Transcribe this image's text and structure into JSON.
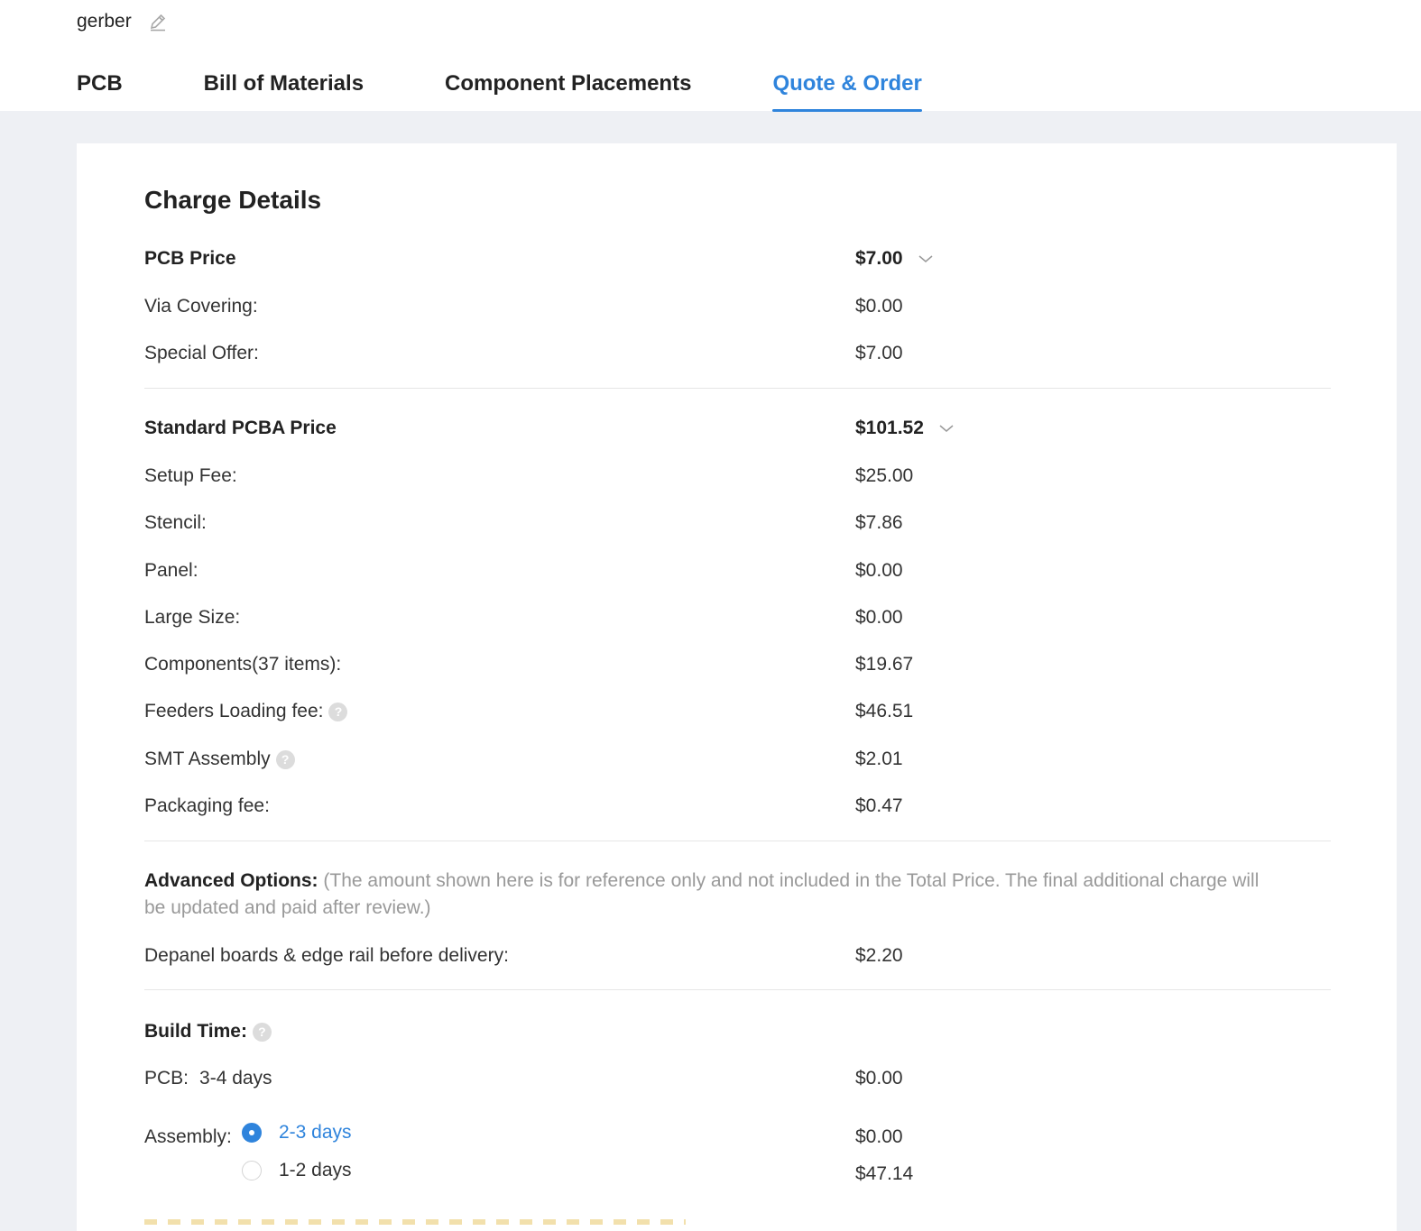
{
  "header": {
    "filename": "gerber"
  },
  "tabs": [
    {
      "label": "PCB"
    },
    {
      "label": "Bill of Materials"
    },
    {
      "label": "Component Placements"
    },
    {
      "label": "Quote & Order"
    }
  ],
  "charge": {
    "title": "Charge Details",
    "pcb": {
      "label": "PCB Price",
      "value": "$7.00",
      "items": [
        {
          "label": "Via Covering:",
          "value": "$0.00"
        },
        {
          "label": "Special Offer:",
          "value": "$7.00"
        }
      ]
    },
    "pcba": {
      "label": "Standard PCBA Price",
      "value": "$101.52",
      "items": [
        {
          "label": "Setup Fee:",
          "value": "$25.00"
        },
        {
          "label": "Stencil:",
          "value": "$7.86"
        },
        {
          "label": "Panel:",
          "value": "$0.00"
        },
        {
          "label": "Large Size:",
          "value": "$0.00"
        },
        {
          "label": "Components(37 items):",
          "value": "$19.67"
        },
        {
          "label": "Feeders Loading fee:",
          "value": "$46.51"
        },
        {
          "label": "SMT Assembly",
          "value": "$2.01"
        },
        {
          "label": "Packaging fee:",
          "value": "$0.47"
        }
      ]
    },
    "advanced": {
      "label": "Advanced Options:",
      "note": "(The amount shown here is for reference only and not included in the Total Price. The final additional charge will be updated and paid after review.)",
      "items": [
        {
          "label": "Depanel boards & edge rail before delivery:",
          "value": "$2.20"
        }
      ]
    },
    "build": {
      "label": "Build Time:",
      "pcb": {
        "label": "PCB:",
        "value": "3-4 days",
        "price": "$0.00"
      },
      "assembly": {
        "label": "Assembly:",
        "options": [
          {
            "label": "2-3 days",
            "price": "$0.00",
            "selected": true
          },
          {
            "label": "1-2 days",
            "price": "$47.14",
            "selected": false
          }
        ]
      }
    }
  },
  "colors": {
    "accent": "#2f84dc",
    "background": "#eef0f4"
  },
  "icons": {
    "edit": "pencil-icon",
    "expand": "chevron-down-icon",
    "help": "question-icon"
  }
}
